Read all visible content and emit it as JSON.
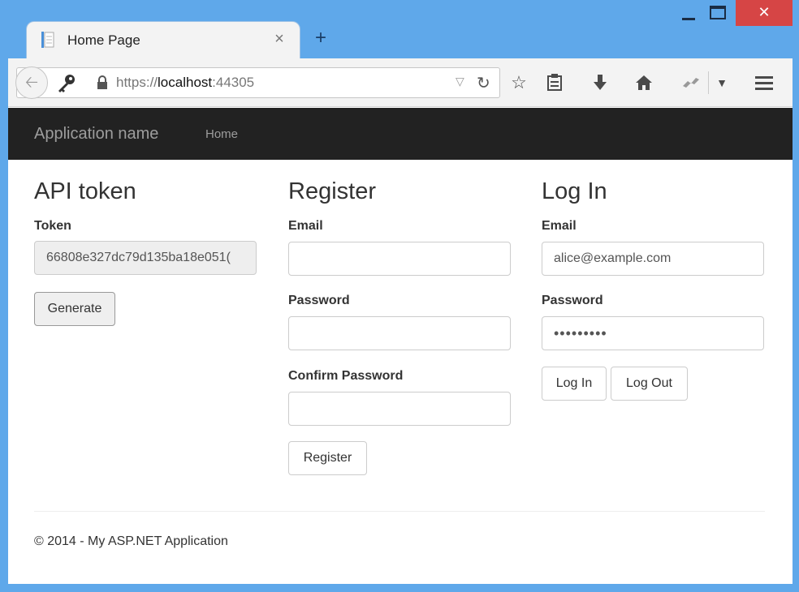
{
  "browser": {
    "tab_title": "Home Page",
    "tab_close": "×",
    "new_tab": "+",
    "window_close": "✕",
    "url_scheme": "https://",
    "url_host": "localhost",
    "url_port": ":44305"
  },
  "navbar": {
    "brand": "Application name",
    "links": [
      {
        "label": "Home"
      }
    ]
  },
  "api_token": {
    "heading": "API token",
    "token_label": "Token",
    "token_value": "66808e327dc79d135ba18e051(",
    "generate_label": "Generate"
  },
  "register": {
    "heading": "Register",
    "email_label": "Email",
    "email_value": "",
    "password_label": "Password",
    "password_value": "",
    "confirm_label": "Confirm Password",
    "confirm_value": "",
    "button_label": "Register"
  },
  "login": {
    "heading": "Log In",
    "email_label": "Email",
    "email_value": "alice@example.com",
    "password_label": "Password",
    "password_value": "•••••••••",
    "login_label": "Log In",
    "logout_label": "Log Out"
  },
  "footer": {
    "text": "© 2014 - My ASP.NET Application"
  }
}
